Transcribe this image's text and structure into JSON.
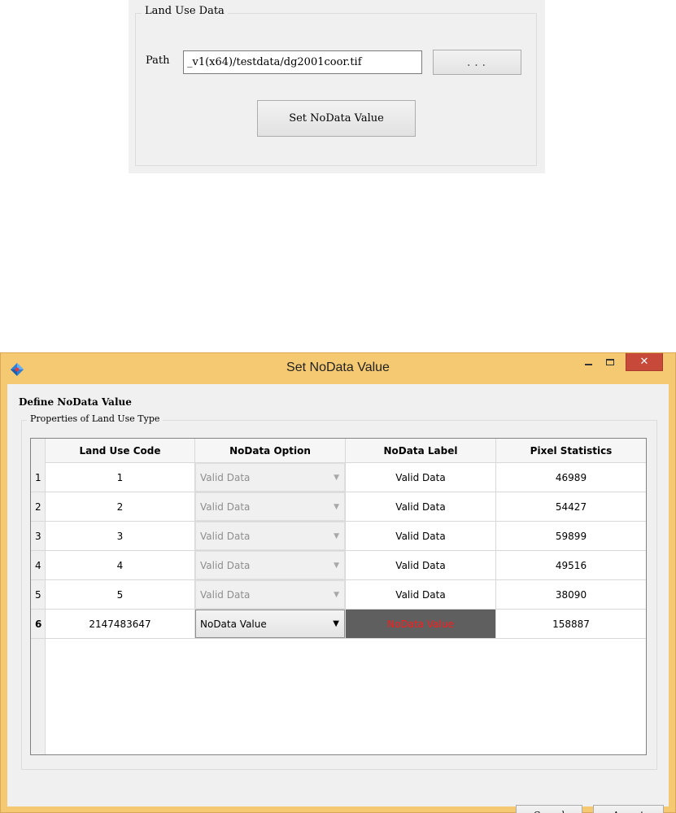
{
  "land_use_panel": {
    "group_title": "Land Use Data",
    "path_label": "Path",
    "path_value": "_v1(x64)/testdata/dg2001coor.tif",
    "browse_label": "...",
    "set_nodata_button": "Set NoData Value"
  },
  "dialog": {
    "title": "Set NoData Value",
    "close_glyph": "✕",
    "define_label": "Define NoData Value",
    "group_title": "Properties of Land Use Type",
    "columns": [
      "Land Use Code",
      "NoData Option",
      "NoData Label",
      "Pixel Statistics"
    ],
    "rows": [
      {
        "index": "1",
        "code": "1",
        "option": "Valid Data",
        "label": "Valid Data",
        "pixels": "46989"
      },
      {
        "index": "2",
        "code": "2",
        "option": "Valid Data",
        "label": "Valid Data",
        "pixels": "54427"
      },
      {
        "index": "3",
        "code": "3",
        "option": "Valid Data",
        "label": "Valid Data",
        "pixels": "59899"
      },
      {
        "index": "4",
        "code": "4",
        "option": "Valid Data",
        "label": "Valid Data",
        "pixels": "49516"
      },
      {
        "index": "5",
        "code": "5",
        "option": "Valid Data",
        "label": "Valid Data",
        "pixels": "38090"
      },
      {
        "index": "6",
        "code": "2147483647",
        "option": "NoData Value",
        "label": "NoData Value",
        "pixels": "158887"
      }
    ],
    "cancel_label": "Cancel",
    "accept_label": "Accept"
  },
  "colors": {
    "window_frame": "#f5c971",
    "close_button": "#c7493a",
    "nodata_label_bg": "#5f5f5f",
    "nodata_label_text": "#ff1a1a"
  },
  "icons": {
    "app": "diamond-app-icon",
    "dropdown": "chevron-down-icon"
  }
}
